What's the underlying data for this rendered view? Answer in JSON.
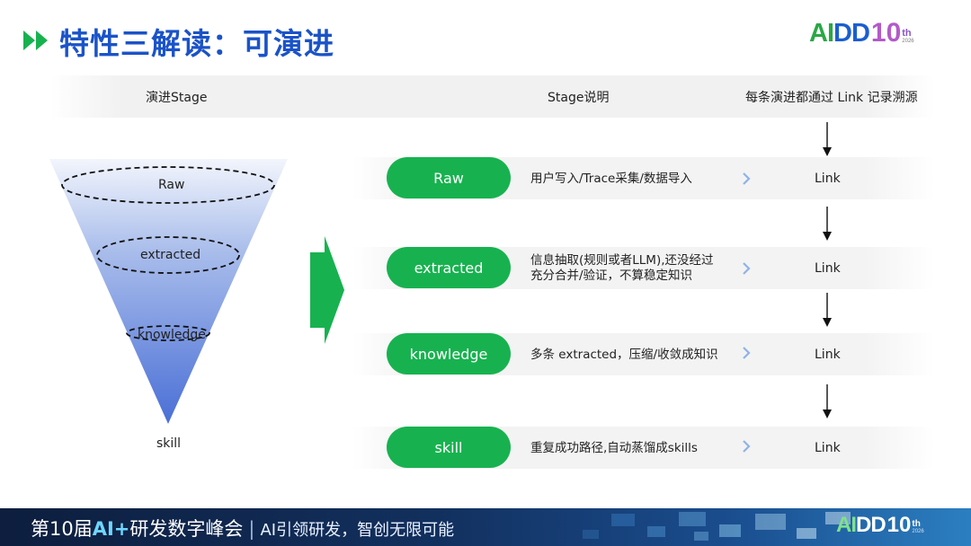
{
  "header": {
    "title": "特性三解读：可演进",
    "logo": {
      "main_a": "AI",
      "main_rest": "DD",
      "ten": "10",
      "suffix": "th",
      "year": "2026"
    }
  },
  "columns": {
    "stage": "演进Stage",
    "description": "Stage说明",
    "trace": "每条演进都通过 Link 记录溯源"
  },
  "funnel": {
    "levels": [
      "Raw",
      "extracted",
      "knowledge",
      "skill"
    ]
  },
  "rows": [
    {
      "stage": "Raw",
      "desc_lines": [
        "用户写入/Trace采集/数据导入"
      ],
      "link": "Link"
    },
    {
      "stage": "extracted",
      "desc_lines": [
        "信息抽取(规则或者LLM),还没经过",
        "充分合并/验证，不算稳定知识"
      ],
      "link": "Link"
    },
    {
      "stage": "knowledge",
      "desc_lines": [
        "多条 extracted，压缩/收敛成知识"
      ],
      "link": "Link"
    },
    {
      "stage": "skill",
      "desc_lines": [
        "重复成功路径,自动蒸馏成skills"
      ],
      "link": "Link"
    }
  ],
  "footer": {
    "prefix": "第10届",
    "ai": "AI+",
    "rest": "研发数字峰会",
    "separator": "|",
    "slogan": "AI引领研发，智创无限可能",
    "logo": {
      "main_a": "AI",
      "main_rest": "DD",
      "ten": "10",
      "suffix": "th",
      "year": "2026"
    }
  },
  "colors": {
    "title_blue": "#1b53c8",
    "pill_green": "#17b24f",
    "funnel_top": "#eaf0fb",
    "funnel_bottom": "#4a6fd6",
    "chevron_blue": "#8fb3e6"
  },
  "icons": {
    "title_marker": "double-play-icon",
    "row_arrow": "chevron-right-icon",
    "flow_arrow": "arrow-down-icon",
    "transition": "big-right-arrow-icon"
  }
}
